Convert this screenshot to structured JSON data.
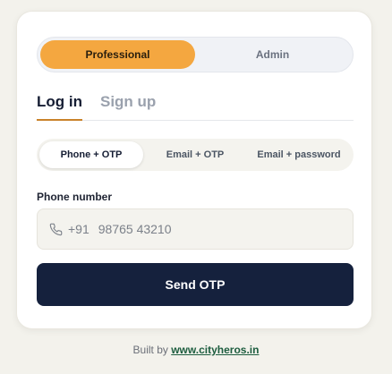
{
  "role_toggle": {
    "professional": "Professional",
    "admin": "Admin",
    "active": "professional"
  },
  "auth_tabs": {
    "login": "Log in",
    "signup": "Sign up",
    "active": "login"
  },
  "method_tabs": {
    "phone_otp": "Phone + OTP",
    "email_otp": "Email + OTP",
    "email_password": "Email + password",
    "active": "phone_otp"
  },
  "phone": {
    "label": "Phone number",
    "country_code": "+91",
    "placeholder": "98765 43210",
    "value": ""
  },
  "send_button": "Send OTP",
  "footer": {
    "prefix": "Built by",
    "link": "www.cityheros.in"
  },
  "colors": {
    "accent": "#f4a740",
    "primary": "#15213d",
    "link": "#1d5d3f",
    "tab_underline": "#c9822a"
  }
}
